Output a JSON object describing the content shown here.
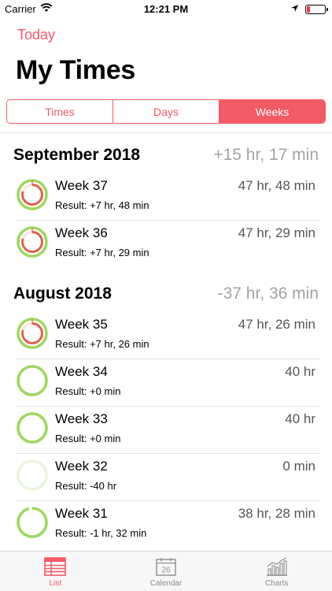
{
  "status_bar": {
    "carrier": "Carrier",
    "time": "12:21 PM"
  },
  "nav": {
    "back_label": "Today",
    "title": "My Times"
  },
  "segments": [
    {
      "label": "Times",
      "selected": false
    },
    {
      "label": "Days",
      "selected": false
    },
    {
      "label": "Weeks",
      "selected": true
    }
  ],
  "sections": [
    {
      "title": "September 2018",
      "total": "+15 hr, 17 min",
      "rows": [
        {
          "title": "Week 37",
          "value": "47 hr, 48 min",
          "result": "Result: +7 hr, 48 min",
          "progress": 1.19,
          "ring_state": "over"
        },
        {
          "title": "Week 36",
          "value": "47 hr, 29 min",
          "result": "Result: +7 hr, 29 min",
          "progress": 1.19,
          "ring_state": "over"
        }
      ]
    },
    {
      "title": "August 2018",
      "total": "-37 hr, 36 min",
      "rows": [
        {
          "title": "Week 35",
          "value": "47 hr, 26 min",
          "result": "Result: +7 hr, 26 min",
          "progress": 1.19,
          "ring_state": "over"
        },
        {
          "title": "Week 34",
          "value": "40 hr",
          "result": "Result: +0 min",
          "progress": 1.0,
          "ring_state": "full"
        },
        {
          "title": "Week 33",
          "value": "40 hr",
          "result": "Result: +0 min",
          "progress": 1.0,
          "ring_state": "full"
        },
        {
          "title": "Week 32",
          "value": "0 min",
          "result": "Result: -40 hr",
          "progress": 0.0,
          "ring_state": "empty"
        },
        {
          "title": "Week 31",
          "value": "38 hr, 28 min",
          "result": "Result: -1 hr, 32 min",
          "progress": 0.96,
          "ring_state": "under"
        }
      ]
    }
  ],
  "tab_bar": [
    {
      "label": "List",
      "icon": "list-icon",
      "active": true
    },
    {
      "label": "Calendar",
      "icon": "calendar-icon",
      "active": false,
      "icon_text": "26"
    },
    {
      "label": "Charts",
      "icon": "charts-icon",
      "active": false
    }
  ],
  "colors": {
    "accent": "#f25a66",
    "ring_green": "#9ed85f",
    "ring_green_light": "#e9f5dc",
    "ring_red": "#e0614f",
    "muted": "#a3a3a3"
  }
}
